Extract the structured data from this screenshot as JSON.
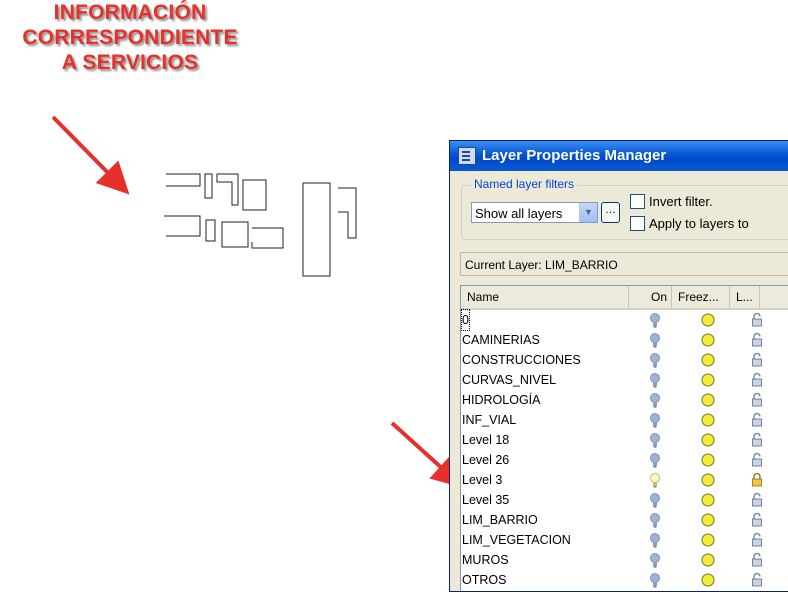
{
  "annotation": {
    "lines": [
      "INFORMACIÓN",
      "CORRESPONDIENTE",
      "A SERVICIOS"
    ],
    "color": "#e8302a"
  },
  "window": {
    "title": "Layer Properties Manager",
    "filters": {
      "group_label": "Named layer filters",
      "selected": "Show all layers",
      "invert_label": "Invert filter.",
      "apply_label": "Apply to layers to"
    },
    "current_layer": "Current Layer:  LIM_BARRIO",
    "columns": [
      "Name",
      "On",
      "Freez...",
      "L..."
    ],
    "layers": [
      {
        "name": "0",
        "on": true,
        "locked": false
      },
      {
        "name": "CAMINERIAS",
        "on": true,
        "locked": false
      },
      {
        "name": "CONSTRUCCIONES",
        "on": true,
        "locked": false
      },
      {
        "name": "CURVAS_NIVEL",
        "on": true,
        "locked": false
      },
      {
        "name": "HIDROLOGÍA",
        "on": true,
        "locked": false
      },
      {
        "name": "INF_VIAL",
        "on": true,
        "locked": false
      },
      {
        "name": "Level 18",
        "on": true,
        "locked": false
      },
      {
        "name": "Level 26",
        "on": true,
        "locked": false
      },
      {
        "name": "Level 3",
        "on": false,
        "locked": true
      },
      {
        "name": "Level 35",
        "on": true,
        "locked": false
      },
      {
        "name": "LIM_BARRIO",
        "on": true,
        "locked": false
      },
      {
        "name": "LIM_VEGETACION",
        "on": true,
        "locked": false
      },
      {
        "name": "MUROS",
        "on": true,
        "locked": false
      },
      {
        "name": "OTROS",
        "on": true,
        "locked": false
      }
    ]
  }
}
